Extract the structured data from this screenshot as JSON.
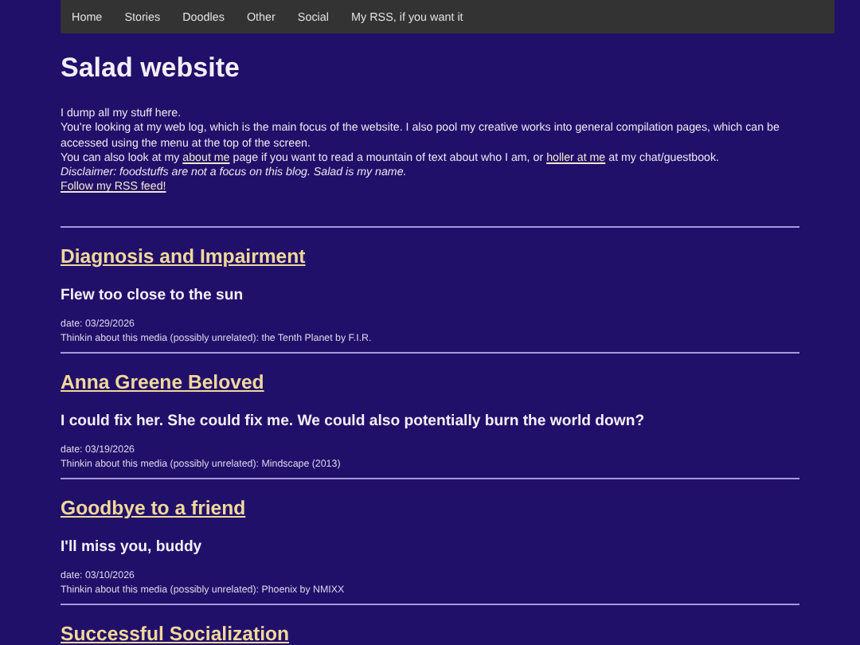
{
  "nav": {
    "items": [
      "Home",
      "Stories",
      "Doodles",
      "Other",
      "Social",
      "My RSS, if you want it"
    ]
  },
  "site_title": "Salad website",
  "intro": {
    "line_1": "I dump all my stuff here.",
    "line_2": "You're looking at my web log, which is the main focus of the website. I also pool my creative works into general compilation pages, which can be accessed using the menu at the top of the screen.",
    "line_3": {
      "before": "You can also look at my",
      "link_1": "about me",
      "middle": "page if you want to read a mountain of text about who I am, or",
      "link_2": "holler at me",
      "after": "at my chat/guestbook."
    },
    "disclaimer": "Disclaimer: foodstuffs are not a focus on this blog. Salad is my name.",
    "rss_link": "Follow my RSS feed!"
  },
  "posts": [
    {
      "title": "Diagnosis and Impairment",
      "subtitle": "Flew too close to the sun",
      "date": "date: 03/29/2026",
      "media": "Thinkin about this media (possibly unrelated): the Tenth Planet by F.I.R."
    },
    {
      "title": "Anna Greene Beloved",
      "subtitle": "I could fix her. She could fix me. We could also potentially burn the world down?",
      "date": "date: 03/19/2026",
      "media": "Thinkin about this media (possibly unrelated): Mindscape (2013)"
    },
    {
      "title": "Goodbye to a friend",
      "subtitle": "I'll miss you, buddy",
      "date": "date: 03/10/2026",
      "media": "Thinkin about this media (possibly unrelated): Phoenix by NMIXX"
    },
    {
      "title": "Successful Socialization"
    }
  ]
}
